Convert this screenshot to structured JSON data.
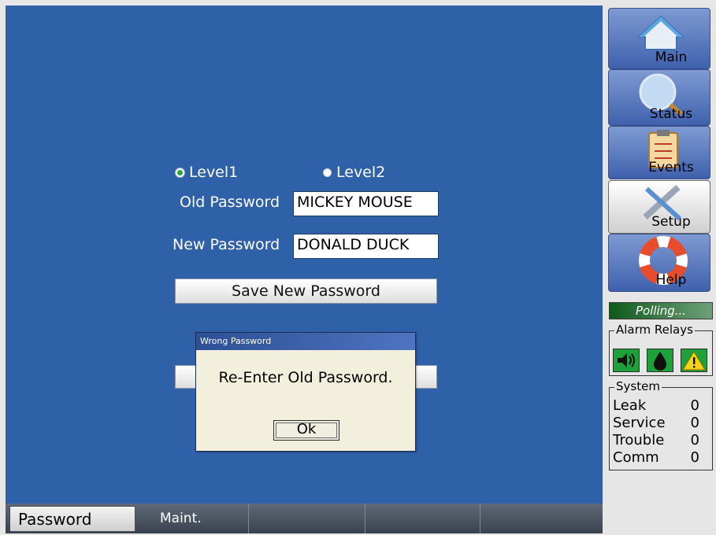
{
  "password_form": {
    "level1_label": "Level1",
    "level2_label": "Level2",
    "selected_level": "Level1",
    "old_password_label": "Old Password",
    "old_password_value": "MICKEY MOUSE",
    "new_password_label": "New Password",
    "new_password_value": "DONALD DUCK",
    "save_button_label": "Save New Password"
  },
  "dialog": {
    "title": "Wrong Password",
    "message": "Re-Enter Old Password.",
    "ok_label": "Ok"
  },
  "tabs": [
    {
      "label": "Password",
      "active": true
    },
    {
      "label": "Maint.",
      "active": false
    },
    {
      "label": "",
      "active": false
    },
    {
      "label": "",
      "active": false
    },
    {
      "label": "",
      "active": false
    }
  ],
  "nav": {
    "main": "Main",
    "status": "Status",
    "events": "Events",
    "setup": "Setup",
    "help": "Help"
  },
  "polling_label": "Polling...",
  "alarm_relays": {
    "title": "Alarm Relays",
    "icons": [
      "speaker-icon",
      "drop-icon",
      "warning-icon"
    ]
  },
  "system": {
    "title": "System",
    "rows": [
      {
        "label": "Leak",
        "value": "0"
      },
      {
        "label": "Service",
        "value": "0"
      },
      {
        "label": "Trouble",
        "value": "0"
      },
      {
        "label": "Comm",
        "value": "0"
      }
    ]
  },
  "colors": {
    "panel_blue": "#2f61a8",
    "selected_radio": "#2aa338",
    "alarm_green": "#1ea03a"
  }
}
